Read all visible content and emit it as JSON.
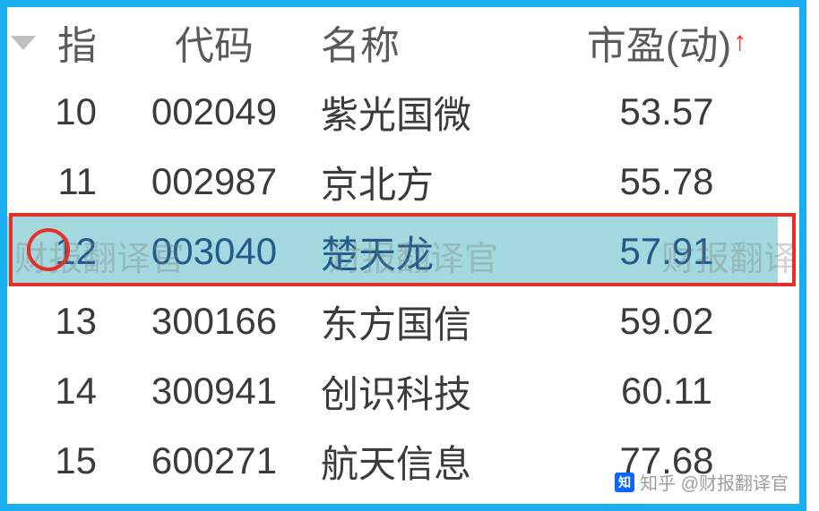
{
  "headers": {
    "idx": "指",
    "code": "代码",
    "name": "名称",
    "pe": "市盈(动)"
  },
  "rows": [
    {
      "idx": "10",
      "code": "002049",
      "name": "紫光国微",
      "pe": "53.57",
      "highlight": false
    },
    {
      "idx": "11",
      "code": "002987",
      "name": "京北方",
      "pe": "55.78",
      "highlight": false
    },
    {
      "idx": "12",
      "code": "003040",
      "name": "楚天龙",
      "pe": "57.91",
      "highlight": true
    },
    {
      "idx": "13",
      "code": "300166",
      "name": "东方国信",
      "pe": "59.02",
      "highlight": false
    },
    {
      "idx": "14",
      "code": "300941",
      "name": "创识科技",
      "pe": "60.11",
      "highlight": false
    },
    {
      "idx": "15",
      "code": "600271",
      "name": "航天信息",
      "pe": "77.68",
      "highlight": false
    }
  ],
  "watermark": "财报翻译官",
  "credit": "知乎 @财报翻译官",
  "chart_data": {
    "type": "table",
    "title": "",
    "columns": [
      "指",
      "代码",
      "名称",
      "市盈(动)"
    ],
    "sort": {
      "column": "市盈(动)",
      "direction": "asc"
    },
    "rows": [
      [
        10,
        "002049",
        "紫光国微",
        53.57
      ],
      [
        11,
        "002987",
        "京北方",
        55.78
      ],
      [
        12,
        "003040",
        "楚天龙",
        57.91
      ],
      [
        13,
        "300166",
        "东方国信",
        59.02
      ],
      [
        14,
        "300941",
        "创识科技",
        60.11
      ],
      [
        15,
        "600271",
        "航天信息",
        77.68
      ]
    ],
    "highlighted_row_index": 2
  }
}
